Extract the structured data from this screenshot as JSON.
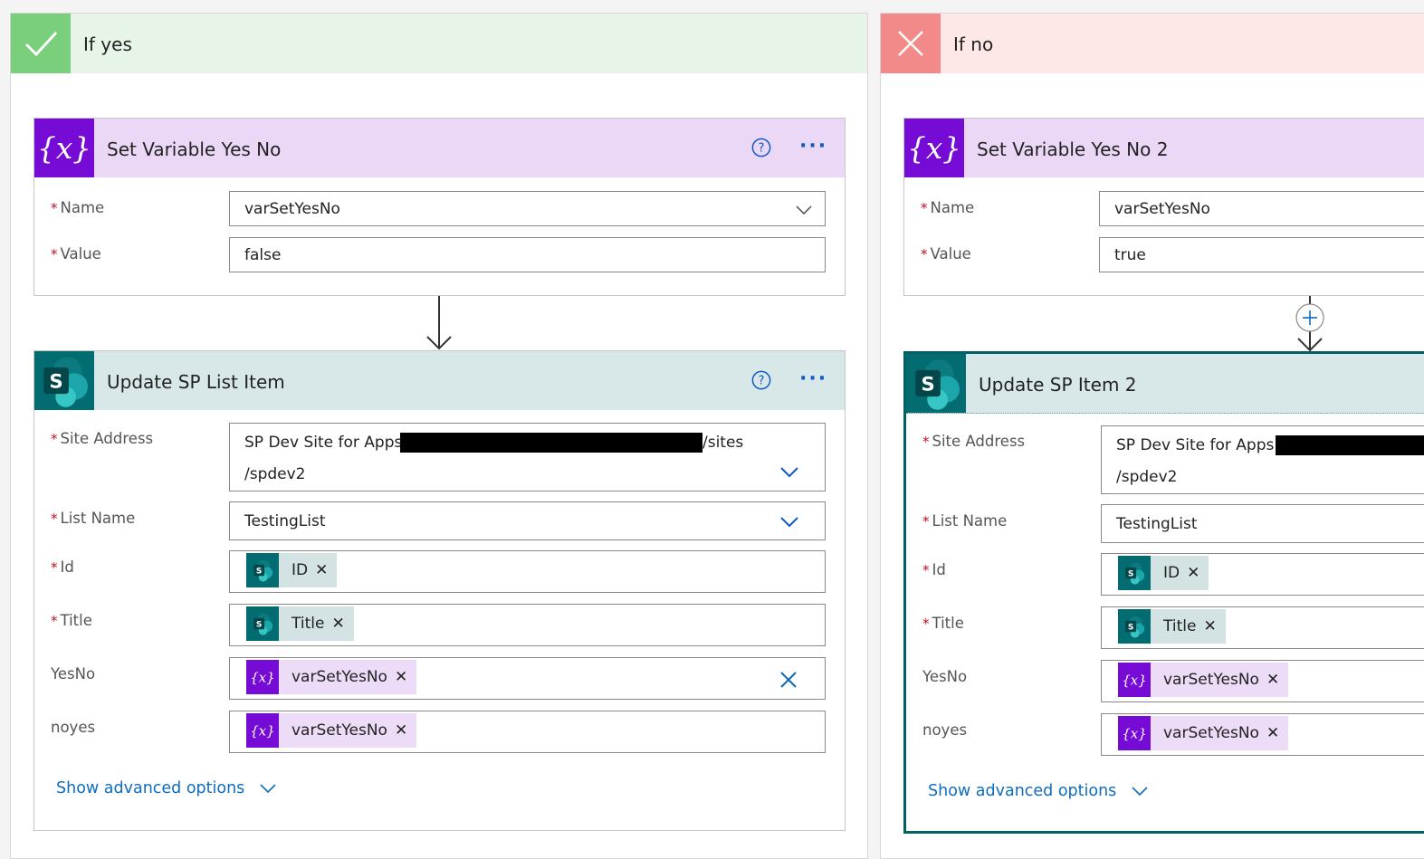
{
  "branches": {
    "yes": {
      "label": "If yes",
      "icon": "checkmark-icon",
      "color": "#79cf7c",
      "set_variable": {
        "title": "Set Variable Yes No",
        "icon": "variable-icon",
        "fields": {
          "name_label": "Name",
          "name_value": "varSetYesNo",
          "value_label": "Value",
          "value_value": "false"
        }
      },
      "update_item": {
        "title": "Update SP List Item",
        "icon": "sharepoint-icon",
        "fields": {
          "site_label": "Site Address",
          "site_value_line1": "SP Dev Site for Apps -",
          "site_value_suffix": "/sites",
          "site_value_line2": "/spdev2",
          "list_label": "List Name",
          "list_value": "TestingList",
          "id_label": "Id",
          "id_token": "ID",
          "title_label": "Title",
          "title_token": "Title",
          "yesno_label": "YesNo",
          "yesno_token": "varSetYesNo",
          "noyes_label": "noyes",
          "noyes_token": "varSetYesNo"
        },
        "advanced": "Show advanced options"
      }
    },
    "no": {
      "label": "If no",
      "icon": "cross-icon",
      "color": "#f38a8a",
      "set_variable": {
        "title": "Set Variable Yes No 2",
        "icon": "variable-icon",
        "fields": {
          "name_label": "Name",
          "name_value": "varSetYesNo",
          "value_label": "Value",
          "value_value": "true"
        }
      },
      "update_item": {
        "title": "Update SP Item 2",
        "icon": "sharepoint-icon",
        "fields": {
          "site_label": "Site Address",
          "site_value_line1": "SP Dev Site for Apps -",
          "site_value_line2": "/spdev2",
          "list_label": "List Name",
          "list_value": "TestingList",
          "id_label": "Id",
          "id_token": "ID",
          "title_label": "Title",
          "title_token": "Title",
          "yesno_label": "YesNo",
          "yesno_token": "varSetYesNo",
          "noyes_label": "noyes",
          "noyes_token": "varSetYesNo"
        },
        "advanced": "Show advanced options"
      }
    }
  },
  "accent": "#0f6cbd",
  "variable_color": "#770bd6",
  "sharepoint_color": "#036c70",
  "required_marker": "*"
}
